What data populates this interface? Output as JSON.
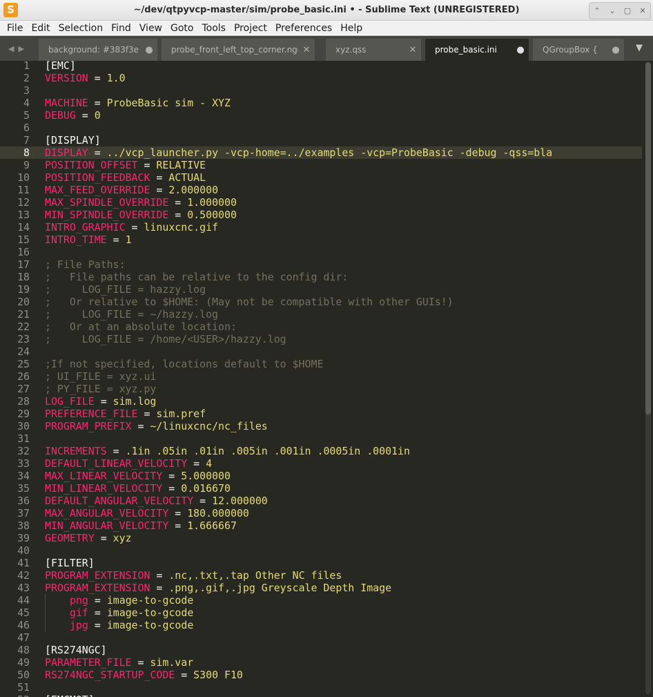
{
  "window": {
    "title": "~/dev/qtpyvcp-master/sim/probe_basic.ini • - Sublime Text (UNREGISTERED)",
    "app_icon": "sublime-text-icon"
  },
  "menu": [
    "File",
    "Edit",
    "Selection",
    "Find",
    "View",
    "Goto",
    "Tools",
    "Project",
    "Preferences",
    "Help"
  ],
  "tabs": [
    {
      "label": "background: #383f3e",
      "mark": "●"
    },
    {
      "label": "probe_front_left_top_corner.ngc",
      "mark": "✕"
    },
    {
      "label": "xyz.qss",
      "mark": "✕"
    },
    {
      "label": "probe_basic.ini",
      "mark": "●"
    },
    {
      "label": "QGroupBox {",
      "mark": "●"
    }
  ],
  "active_tab": 3,
  "current_line": 8,
  "editor_lines": [
    {
      "n": 1,
      "t": "section",
      "text": "[EMC]"
    },
    {
      "n": 2,
      "t": "kv",
      "key": "VERSION",
      "val": "1.0"
    },
    {
      "n": 3,
      "t": "blank"
    },
    {
      "n": 4,
      "t": "kv",
      "key": "MACHINE",
      "val": "ProbeBasic sim - XYZ"
    },
    {
      "n": 5,
      "t": "kv",
      "key": "DEBUG",
      "val": "0"
    },
    {
      "n": 6,
      "t": "blank"
    },
    {
      "n": 7,
      "t": "section",
      "text": "[DISPLAY]"
    },
    {
      "n": 8,
      "t": "kv",
      "key": "DISPLAY",
      "val": "../vcp_launcher.py -vcp-home=../examples -vcp=ProbeBasic -debug -qss=bla"
    },
    {
      "n": 9,
      "t": "kv",
      "key": "POSITION_OFFSET",
      "val": "RELATIVE"
    },
    {
      "n": 10,
      "t": "kv",
      "key": "POSITION_FEEDBACK",
      "val": "ACTUAL"
    },
    {
      "n": 11,
      "t": "kv",
      "key": "MAX_FEED_OVERRIDE",
      "val": "2.000000"
    },
    {
      "n": 12,
      "t": "kv",
      "key": "MAX_SPINDLE_OVERRIDE",
      "val": "1.000000"
    },
    {
      "n": 13,
      "t": "kv",
      "key": "MIN_SPINDLE_OVERRIDE",
      "val": "0.500000"
    },
    {
      "n": 14,
      "t": "kv",
      "key": "INTRO_GRAPHIC",
      "val": "linuxcnc.gif"
    },
    {
      "n": 15,
      "t": "kv",
      "key": "INTRO_TIME",
      "val": "1"
    },
    {
      "n": 16,
      "t": "blank"
    },
    {
      "n": 17,
      "t": "comment",
      "text": "; File Paths:"
    },
    {
      "n": 18,
      "t": "comment",
      "text": ";   File paths can be relative to the config dir:"
    },
    {
      "n": 19,
      "t": "comment",
      "text": ";     LOG_FILE = hazzy.log"
    },
    {
      "n": 20,
      "t": "comment",
      "text": ";   Or relative to $HOME: (May not be compatible with other GUIs!)"
    },
    {
      "n": 21,
      "t": "comment",
      "text": ";     LOG_FILE = ~/hazzy.log"
    },
    {
      "n": 22,
      "t": "comment",
      "text": ";   Or at an absolute location:"
    },
    {
      "n": 23,
      "t": "comment",
      "text": ";     LOG_FILE = /home/<USER>/hazzy.log"
    },
    {
      "n": 24,
      "t": "blank"
    },
    {
      "n": 25,
      "t": "comment",
      "text": ";If not specified, locations default to $HOME"
    },
    {
      "n": 26,
      "t": "comment",
      "text": "; UI_FILE = xyz.ui"
    },
    {
      "n": 27,
      "t": "comment",
      "text": "; PY_FILE = xyz.py"
    },
    {
      "n": 28,
      "t": "kv",
      "key": "LOG_FILE",
      "val": "sim.log"
    },
    {
      "n": 29,
      "t": "kv",
      "key": "PREFERENCE_FILE",
      "val": "sim.pref"
    },
    {
      "n": 30,
      "t": "kv",
      "key": "PROGRAM_PREFIX",
      "val": "~/linuxcnc/nc_files"
    },
    {
      "n": 31,
      "t": "blank"
    },
    {
      "n": 32,
      "t": "kv",
      "key": "INCREMENTS",
      "val": ".1in .05in .01in .005in .001in .0005in .0001in"
    },
    {
      "n": 33,
      "t": "kv",
      "key": "DEFAULT_LINEAR_VELOCITY",
      "val": "4"
    },
    {
      "n": 34,
      "t": "kv",
      "key": "MAX_LINEAR_VELOCITY",
      "val": "5.000000"
    },
    {
      "n": 35,
      "t": "kv",
      "key": "MIN_LINEAR_VELOCITY",
      "val": "0.016670"
    },
    {
      "n": 36,
      "t": "kv",
      "key": "DEFAULT_ANGULAR_VELOCITY",
      "val": "12.000000"
    },
    {
      "n": 37,
      "t": "kv",
      "key": "MAX_ANGULAR_VELOCITY",
      "val": "180.000000"
    },
    {
      "n": 38,
      "t": "kv",
      "key": "MIN_ANGULAR_VELOCITY",
      "val": "1.666667"
    },
    {
      "n": 39,
      "t": "kv",
      "key": "GEOMETRY",
      "val": "xyz"
    },
    {
      "n": 40,
      "t": "blank"
    },
    {
      "n": 41,
      "t": "section",
      "text": "[FILTER]"
    },
    {
      "n": 42,
      "t": "kv",
      "key": "PROGRAM_EXTENSION",
      "val": ".nc,.txt,.tap Other NC files"
    },
    {
      "n": 43,
      "t": "kv",
      "key": "PROGRAM_EXTENSION",
      "val": ".png,.gif,.jpg Greyscale Depth Image"
    },
    {
      "n": 44,
      "t": "kv",
      "indent": true,
      "key": "png",
      "val": "image-to-gcode"
    },
    {
      "n": 45,
      "t": "kv",
      "indent": true,
      "key": "gif",
      "val": "image-to-gcode"
    },
    {
      "n": 46,
      "t": "kv",
      "indent": true,
      "key": "jpg",
      "val": "image-to-gcode"
    },
    {
      "n": 47,
      "t": "blank"
    },
    {
      "n": 48,
      "t": "section",
      "text": "[RS274NGC]"
    },
    {
      "n": 49,
      "t": "kv",
      "key": "PARAMETER_FILE",
      "val": "sim.var"
    },
    {
      "n": 50,
      "t": "kv",
      "key": "RS274NGC_STARTUP_CODE",
      "val": "S300 F10"
    },
    {
      "n": 51,
      "t": "blank"
    },
    {
      "n": 52,
      "t": "section",
      "text": "[EMCMOT]"
    }
  ],
  "colors": {
    "background": "#272822",
    "key": "#f92672",
    "value": "#e6db74",
    "comment": "#75715e",
    "text": "#f8f8f2"
  }
}
